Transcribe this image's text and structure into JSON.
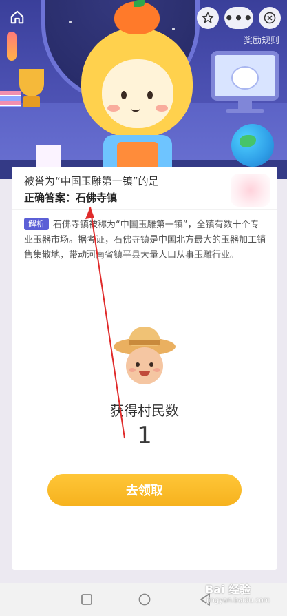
{
  "header": {
    "rules_link": "奖励规则",
    "icons": {
      "home": "home-icon",
      "star": "star-icon",
      "more": "more-icon",
      "close": "close-icon"
    },
    "more_label": "•••"
  },
  "card": {
    "question": "被誉为“中国玉雕第一镇”的是",
    "answer": "正确答案：石佛寺镇",
    "analysis_tag": "解析",
    "analysis_text": "石佛寺镇被称为“中国玉雕第一镇”，全镇有数十个专业玉器市场。据考证，石佛寺镇是中国北方最大的玉器加工销售集散地，带动河南省镇平县大量人口从事玉雕行业。",
    "reward_label": "获得村民数",
    "reward_count": "1",
    "claim_button": "去领取"
  },
  "watermark": {
    "brand": "Bai 经验",
    "sub": "jingyan.baidu.com"
  },
  "colors": {
    "accent_purple": "#5b5fd6",
    "button_yellow": "#f6b21e",
    "annotation_red": "#e02a2a"
  }
}
